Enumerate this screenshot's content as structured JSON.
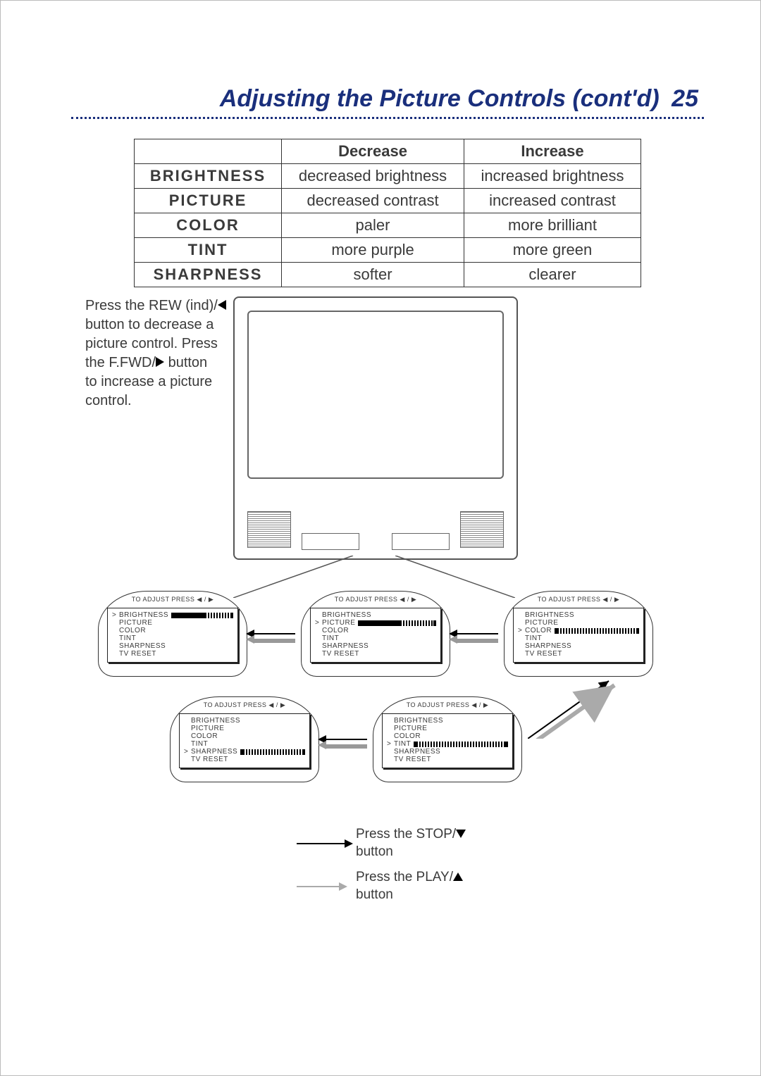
{
  "page": {
    "title": "Adjusting the Picture Controls (cont'd)",
    "number": "25"
  },
  "table": {
    "headers": {
      "decrease": "Decrease",
      "increase": "Increase"
    },
    "rows": [
      {
        "label": "BRIGHTNESS",
        "dec": "decreased brightness",
        "inc": "increased brightness"
      },
      {
        "label": "PICTURE",
        "dec": "decreased contrast",
        "inc": "increased contrast"
      },
      {
        "label": "COLOR",
        "dec": "paler",
        "inc": "more brilliant"
      },
      {
        "label": "TINT",
        "dec": "more purple",
        "inc": "more green"
      },
      {
        "label": "SHARPNESS",
        "dec": "softer",
        "inc": "clearer"
      }
    ]
  },
  "instruction": {
    "line1": "Press the REW (ind)/",
    "line2": "button to decrease a",
    "line3": "picture control. Press",
    "line4": "the F.FWD/",
    "line4b": " button",
    "line5": "to increase a picture",
    "line6": "control."
  },
  "osd": {
    "header": "TO ADJUST PRESS ◀ / ▶",
    "items": [
      "BRIGHTNESS",
      "PICTURE",
      "COLOR",
      "TINT",
      "SHARPNESS",
      "TV RESET"
    ],
    "panels": [
      {
        "id": "osd1",
        "selected": "BRIGHTNESS"
      },
      {
        "id": "osd2",
        "selected": "PICTURE"
      },
      {
        "id": "osd3",
        "selected": "COLOR"
      },
      {
        "id": "osd4",
        "selected": "SHARPNESS"
      },
      {
        "id": "osd5",
        "selected": "TINT"
      }
    ]
  },
  "legend": {
    "stop": "Press the STOP/",
    "stop_after": "button",
    "play": "Press the PLAY/",
    "play_after": "button"
  }
}
